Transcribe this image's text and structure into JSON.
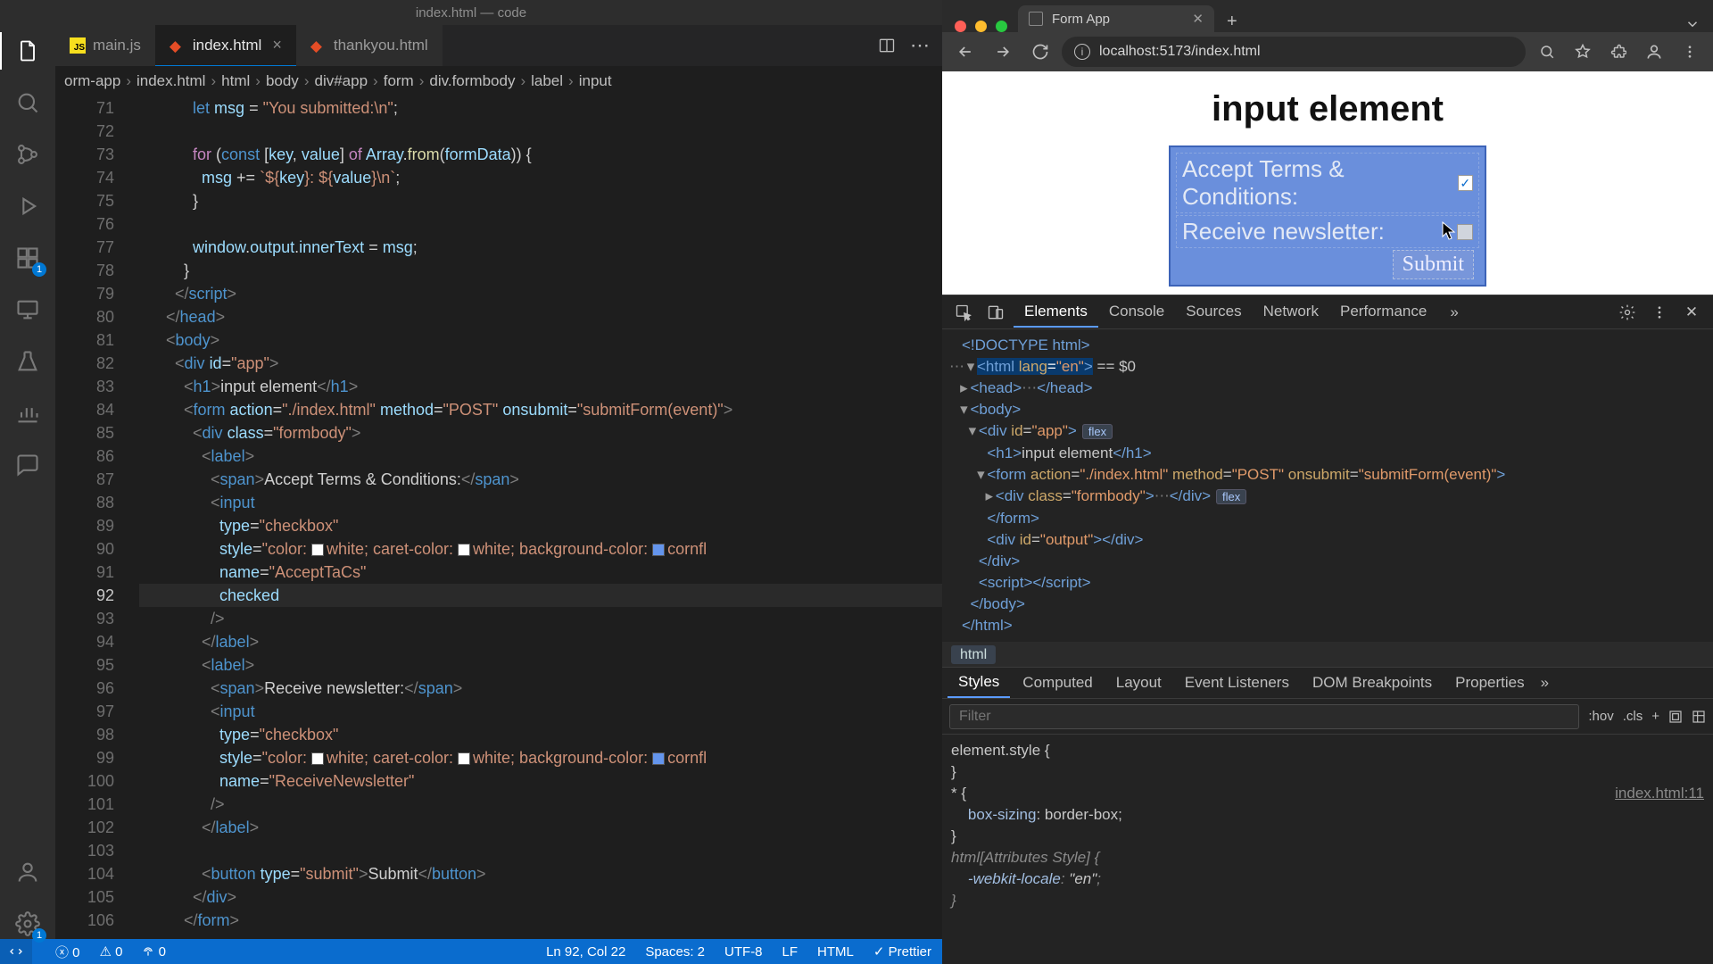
{
  "vscode": {
    "title": "index.html — code",
    "activity_badges": {
      "extensions": "1",
      "settings": "1"
    },
    "tabs": [
      {
        "label": "main.js",
        "kind": "js"
      },
      {
        "label": "index.html",
        "kind": "html",
        "active": true,
        "dirty": false,
        "close": true
      },
      {
        "label": "thankyou.html",
        "kind": "html"
      }
    ],
    "breadcrumbs": [
      "orm-app",
      "index.html",
      "html",
      "body",
      "div#app",
      "form",
      "div.formbody",
      "label",
      "input"
    ],
    "line_numbers_start": 71,
    "current_line": 92,
    "code_lines": [
      {
        "n": 71,
        "html": "            <span class='k2'>let</span> <span class='v'>msg</span> <span class='n'>=</span> <span class='s'>\"You submitted:\\n\"</span><span class='n'>;</span>"
      },
      {
        "n": 72,
        "html": ""
      },
      {
        "n": 73,
        "html": "            <span class='k'>for</span> <span class='n'>(</span><span class='k2'>const</span> <span class='n'>[</span><span class='v'>key</span><span class='n'>,</span> <span class='v'>value</span><span class='n'>]</span> <span class='k'>of</span> <span class='v'>Array</span><span class='n'>.</span><span class='fn'>from</span><span class='n'>(</span><span class='v'>formData</span><span class='n'>)) {</span>"
      },
      {
        "n": 74,
        "html": "              <span class='v'>msg</span> <span class='n'>+=</span> <span class='s'>`${</span><span class='v'>key</span><span class='s'>}: ${</span><span class='v'>value</span><span class='s'>}\\n`</span><span class='n'>;</span>"
      },
      {
        "n": 75,
        "html": "            <span class='n'>}</span>"
      },
      {
        "n": 76,
        "html": ""
      },
      {
        "n": 77,
        "html": "            <span class='v'>window</span><span class='n'>.</span><span class='v'>output</span><span class='n'>.</span><span class='v'>innerText</span> <span class='n'>=</span> <span class='v'>msg</span><span class='n'>;</span>"
      },
      {
        "n": 78,
        "html": "          <span class='n'>}</span>"
      },
      {
        "n": 79,
        "html": "        <span class='p'>&lt;/</span><span class='t'>script</span><span class='p'>&gt;</span>"
      },
      {
        "n": 80,
        "html": "      <span class='p'>&lt;/</span><span class='t'>head</span><span class='p'>&gt;</span>"
      },
      {
        "n": 81,
        "html": "      <span class='p'>&lt;</span><span class='t'>body</span><span class='p'>&gt;</span>"
      },
      {
        "n": 82,
        "html": "        <span class='p'>&lt;</span><span class='t'>div</span> <span class='a'>id</span><span class='n'>=</span><span class='s'>\"app\"</span><span class='p'>&gt;</span>"
      },
      {
        "n": 83,
        "html": "          <span class='p'>&lt;</span><span class='t'>h1</span><span class='p'>&gt;</span><span class='w'>input element</span><span class='p'>&lt;/</span><span class='t'>h1</span><span class='p'>&gt;</span>"
      },
      {
        "n": 84,
        "html": "          <span class='p'>&lt;</span><span class='t'>form</span> <span class='a'>action</span><span class='n'>=</span><span class='s'>\"./index.html\"</span> <span class='a'>method</span><span class='n'>=</span><span class='s'>\"POST\"</span> <span class='a'>onsubmit</span><span class='n'>=</span><span class='s'>\"submitForm(event)\"</span><span class='p'>&gt;</span>"
      },
      {
        "n": 85,
        "html": "            <span class='p'>&lt;</span><span class='t'>div</span> <span class='a'>class</span><span class='n'>=</span><span class='s'>\"formbody\"</span><span class='p'>&gt;</span>"
      },
      {
        "n": 86,
        "html": "              <span class='p'>&lt;</span><span class='t'>label</span><span class='p'>&gt;</span>"
      },
      {
        "n": 87,
        "html": "                <span class='p'>&lt;</span><span class='t'>span</span><span class='p'>&gt;</span><span class='w'>Accept Terms &amp; Conditions:</span><span class='p'>&lt;/</span><span class='t'>span</span><span class='p'>&gt;</span>"
      },
      {
        "n": 88,
        "html": "                <span class='p'>&lt;</span><span class='t'>input</span>"
      },
      {
        "n": 89,
        "html": "                  <span class='a'>type</span><span class='n'>=</span><span class='s'>\"checkbox\"</span>"
      },
      {
        "n": 90,
        "html": "                  <span class='a'>style</span><span class='n'>=</span><span class='s'>\"color: </span><span class='sw white'></span><span class='s'>white; caret-color: </span><span class='sw white'></span><span class='s'>white; background-color: </span><span class='sw blue'></span><span class='s'>cornfl</span>"
      },
      {
        "n": 91,
        "html": "                  <span class='a'>name</span><span class='n'>=</span><span class='s'>\"AcceptTaCs\"</span>"
      },
      {
        "n": 92,
        "html": "                  <span class='a'>checked</span>"
      },
      {
        "n": 93,
        "html": "                <span class='p'>/&gt;</span>"
      },
      {
        "n": 94,
        "html": "              <span class='p'>&lt;/</span><span class='t'>label</span><span class='p'>&gt;</span>"
      },
      {
        "n": 95,
        "html": "              <span class='p'>&lt;</span><span class='t'>label</span><span class='p'>&gt;</span>"
      },
      {
        "n": 96,
        "html": "                <span class='p'>&lt;</span><span class='t'>span</span><span class='p'>&gt;</span><span class='w'>Receive newsletter:</span><span class='p'>&lt;/</span><span class='t'>span</span><span class='p'>&gt;</span>"
      },
      {
        "n": 97,
        "html": "                <span class='p'>&lt;</span><span class='t'>input</span>"
      },
      {
        "n": 98,
        "html": "                  <span class='a'>type</span><span class='n'>=</span><span class='s'>\"checkbox\"</span>"
      },
      {
        "n": 99,
        "html": "                  <span class='a'>style</span><span class='n'>=</span><span class='s'>\"color: </span><span class='sw white'></span><span class='s'>white; caret-color: </span><span class='sw white'></span><span class='s'>white; background-color: </span><span class='sw blue'></span><span class='s'>cornfl</span>"
      },
      {
        "n": 100,
        "html": "                  <span class='a'>name</span><span class='n'>=</span><span class='s'>\"ReceiveNewsletter\"</span>"
      },
      {
        "n": 101,
        "html": "                <span class='p'>/&gt;</span>"
      },
      {
        "n": 102,
        "html": "              <span class='p'>&lt;/</span><span class='t'>label</span><span class='p'>&gt;</span>"
      },
      {
        "n": 103,
        "html": ""
      },
      {
        "n": 104,
        "html": "              <span class='p'>&lt;</span><span class='t'>button</span> <span class='a'>type</span><span class='n'>=</span><span class='s'>\"submit\"</span><span class='p'>&gt;</span><span class='w'>Submit</span><span class='p'>&lt;/</span><span class='t'>button</span><span class='p'>&gt;</span>"
      },
      {
        "n": 105,
        "html": "            <span class='p'>&lt;/</span><span class='t'>div</span><span class='p'>&gt;</span>"
      },
      {
        "n": 106,
        "html": "          <span class='p'>&lt;/</span><span class='t'>form</span><span class='p'>&gt;</span>"
      }
    ],
    "status": {
      "errors": "0",
      "warnings": "0",
      "ports": "0",
      "cursor": "Ln 92, Col 22",
      "spaces": "Spaces: 2",
      "encoding": "UTF-8",
      "eol": "LF",
      "lang": "HTML",
      "formatter": "Prettier",
      "formatter_prefix": "✓ "
    }
  },
  "browser": {
    "tab_title": "Form App",
    "url": "localhost:5173/index.html",
    "newtab": "+",
    "page": {
      "heading": "input element",
      "row1": "Accept Terms & Conditions:",
      "row2": "Receive newsletter:",
      "submit": "Submit",
      "row1_checked": true,
      "row2_checked": false
    }
  },
  "devtools": {
    "tabs": [
      "Elements",
      "Console",
      "Sources",
      "Network",
      "Performance"
    ],
    "active_tab": "Elements",
    "dom": [
      {
        "indent": 0,
        "caret": "",
        "html": "<span class='tg'>&lt;!DOCTYPE html&gt;</span>"
      },
      {
        "indent": 0,
        "caret": "▾",
        "html": "<span class='sel'><span class='tg'>&lt;html </span><span class='at'>lang</span>=<span class='av'>\"en\"</span><span class='tg'>&gt;</span></span> <span class='tx'>== $0</span>",
        "dots_before": true
      },
      {
        "indent": 1,
        "caret": "▸",
        "html": "<span class='tg'>&lt;head&gt;</span><span class='dots'>⋯</span><span class='tg'>&lt;/head&gt;</span>"
      },
      {
        "indent": 1,
        "caret": "▾",
        "html": "<span class='tg'>&lt;body&gt;</span>"
      },
      {
        "indent": 2,
        "caret": "▾",
        "html": "<span class='tg'>&lt;div </span><span class='at'>id</span>=<span class='av'>\"app\"</span><span class='tg'>&gt;</span><span class='pill'>flex</span>"
      },
      {
        "indent": 3,
        "caret": "",
        "html": "<span class='tg'>&lt;h1&gt;</span><span class='tx'>input element</span><span class='tg'>&lt;/h1&gt;</span>"
      },
      {
        "indent": 3,
        "caret": "▾",
        "html": "<span class='tg'>&lt;form </span><span class='at'>action</span>=<span class='av'>\"./index.html\"</span> <span class='at'>method</span>=<span class='av'>\"POST\"</span> <span class='at'>onsubmit</span>=<span class='av'>\"submitForm(event)\"</span><span class='tg'>&gt;</span>"
      },
      {
        "indent": 4,
        "caret": "▸",
        "html": "<span class='tg'>&lt;div </span><span class='at'>class</span>=<span class='av'>\"formbody\"</span><span class='tg'>&gt;</span><span class='dots'>⋯</span><span class='tg'>&lt;/div&gt;</span><span class='pill'>flex</span>"
      },
      {
        "indent": 3,
        "caret": "",
        "html": "<span class='tg'>&lt;/form&gt;</span>"
      },
      {
        "indent": 3,
        "caret": "",
        "html": "<span class='tg'>&lt;div </span><span class='at'>id</span>=<span class='av'>\"output\"</span><span class='tg'>&gt;&lt;/div&gt;</span>"
      },
      {
        "indent": 2,
        "caret": "",
        "html": "<span class='tg'>&lt;/div&gt;</span>"
      },
      {
        "indent": 2,
        "caret": "",
        "html": "<span class='tg'>&lt;script&gt;&lt;/script&gt;</span>"
      },
      {
        "indent": 1,
        "caret": "",
        "html": "<span class='tg'>&lt;/body&gt;</span>"
      },
      {
        "indent": 0,
        "caret": "",
        "html": "<span class='tg'>&lt;/html&gt;</span>"
      }
    ],
    "breadcrumb": "html",
    "subtabs": [
      "Styles",
      "Computed",
      "Layout",
      "Event Listeners",
      "DOM Breakpoints",
      "Properties"
    ],
    "active_subtab": "Styles",
    "filter_placeholder": "Filter",
    "filter_btns": [
      ":hov",
      ".cls",
      "+"
    ],
    "styles": [
      {
        "html": "<span class='sel2'>element.style {</span>"
      },
      {
        "html": "<span class='sel2'>}</span>"
      },
      {
        "html": "<span class='sel2'>* {</span><span class='src'>index.html:11</span>"
      },
      {
        "html": "    <span class='prop'>box-sizing</span>: <span class='val'>border-box</span>;"
      },
      {
        "html": "<span class='sel2'>}</span>"
      },
      {
        "html": "<span class='ital'>html[Attributes Style] {</span>"
      },
      {
        "html": "    <span class='ital'><span class='prop'>-webkit-locale</span>: <span class='val'>\"en\"</span>;</span>"
      },
      {
        "html": "<span class='ital'>}</span>"
      }
    ]
  }
}
